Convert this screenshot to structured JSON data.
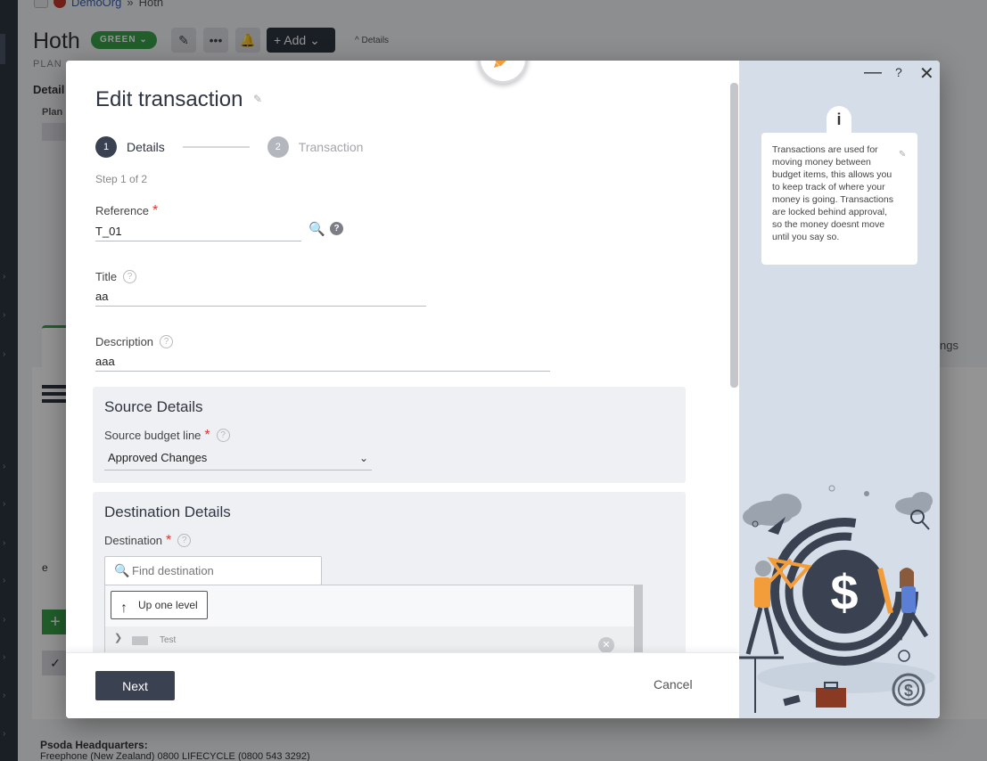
{
  "background": {
    "breadcrumb": {
      "org": "DemoOrg",
      "separator": "»",
      "current": "Hoth"
    },
    "page_title": "Hoth",
    "status_badge": "GREEN ⌄",
    "subtitle": "PLAN",
    "details_link": "^ Details",
    "add_button": "+ Add ⌄",
    "details_tab": "Detail",
    "plan_label": "Plan",
    "tab_right_label": "ngs",
    "row_letter": "e",
    "footer": {
      "line1": "Psoda Headquarters:",
      "line2": "Freephone (New Zealand) 0800 LIFECYCLE (0800 543 3292)"
    }
  },
  "modal": {
    "title": "Edit transaction",
    "steps": [
      {
        "number": "1",
        "label": "Details",
        "active": true
      },
      {
        "number": "2",
        "label": "Transaction",
        "active": false
      }
    ],
    "step_count": "Step 1 of 2",
    "fields": {
      "reference": {
        "label": "Reference",
        "value": "T_01"
      },
      "title": {
        "label": "Title",
        "value": "aa"
      },
      "description": {
        "label": "Description",
        "value": "aaa"
      }
    },
    "source_section": {
      "title": "Source Details",
      "budget_line_label": "Source budget line",
      "budget_line_value": "Approved Changes"
    },
    "destination_section": {
      "title": "Destination Details",
      "destination_label": "Destination",
      "find_placeholder": "Find destination",
      "up_one_level": "Up one level",
      "tree_items": [
        {
          "label": "Test"
        }
      ]
    },
    "footer": {
      "next_label": "Next",
      "cancel_label": "Cancel"
    }
  },
  "help_panel": {
    "info_icon": "i",
    "help_symbol": "?",
    "info_text": "Transactions are used for moving money between budget items, this allows you to keep track of where your money is going. Transactions are locked behind approval, so the money doesnt move until you say so."
  },
  "colors": {
    "primary_dark": "#3a4252",
    "accent_orange": "#f39c3a",
    "required_red": "#d23b3b",
    "panel_bg": "#d4dde8",
    "status_green": "#3aa34b"
  }
}
